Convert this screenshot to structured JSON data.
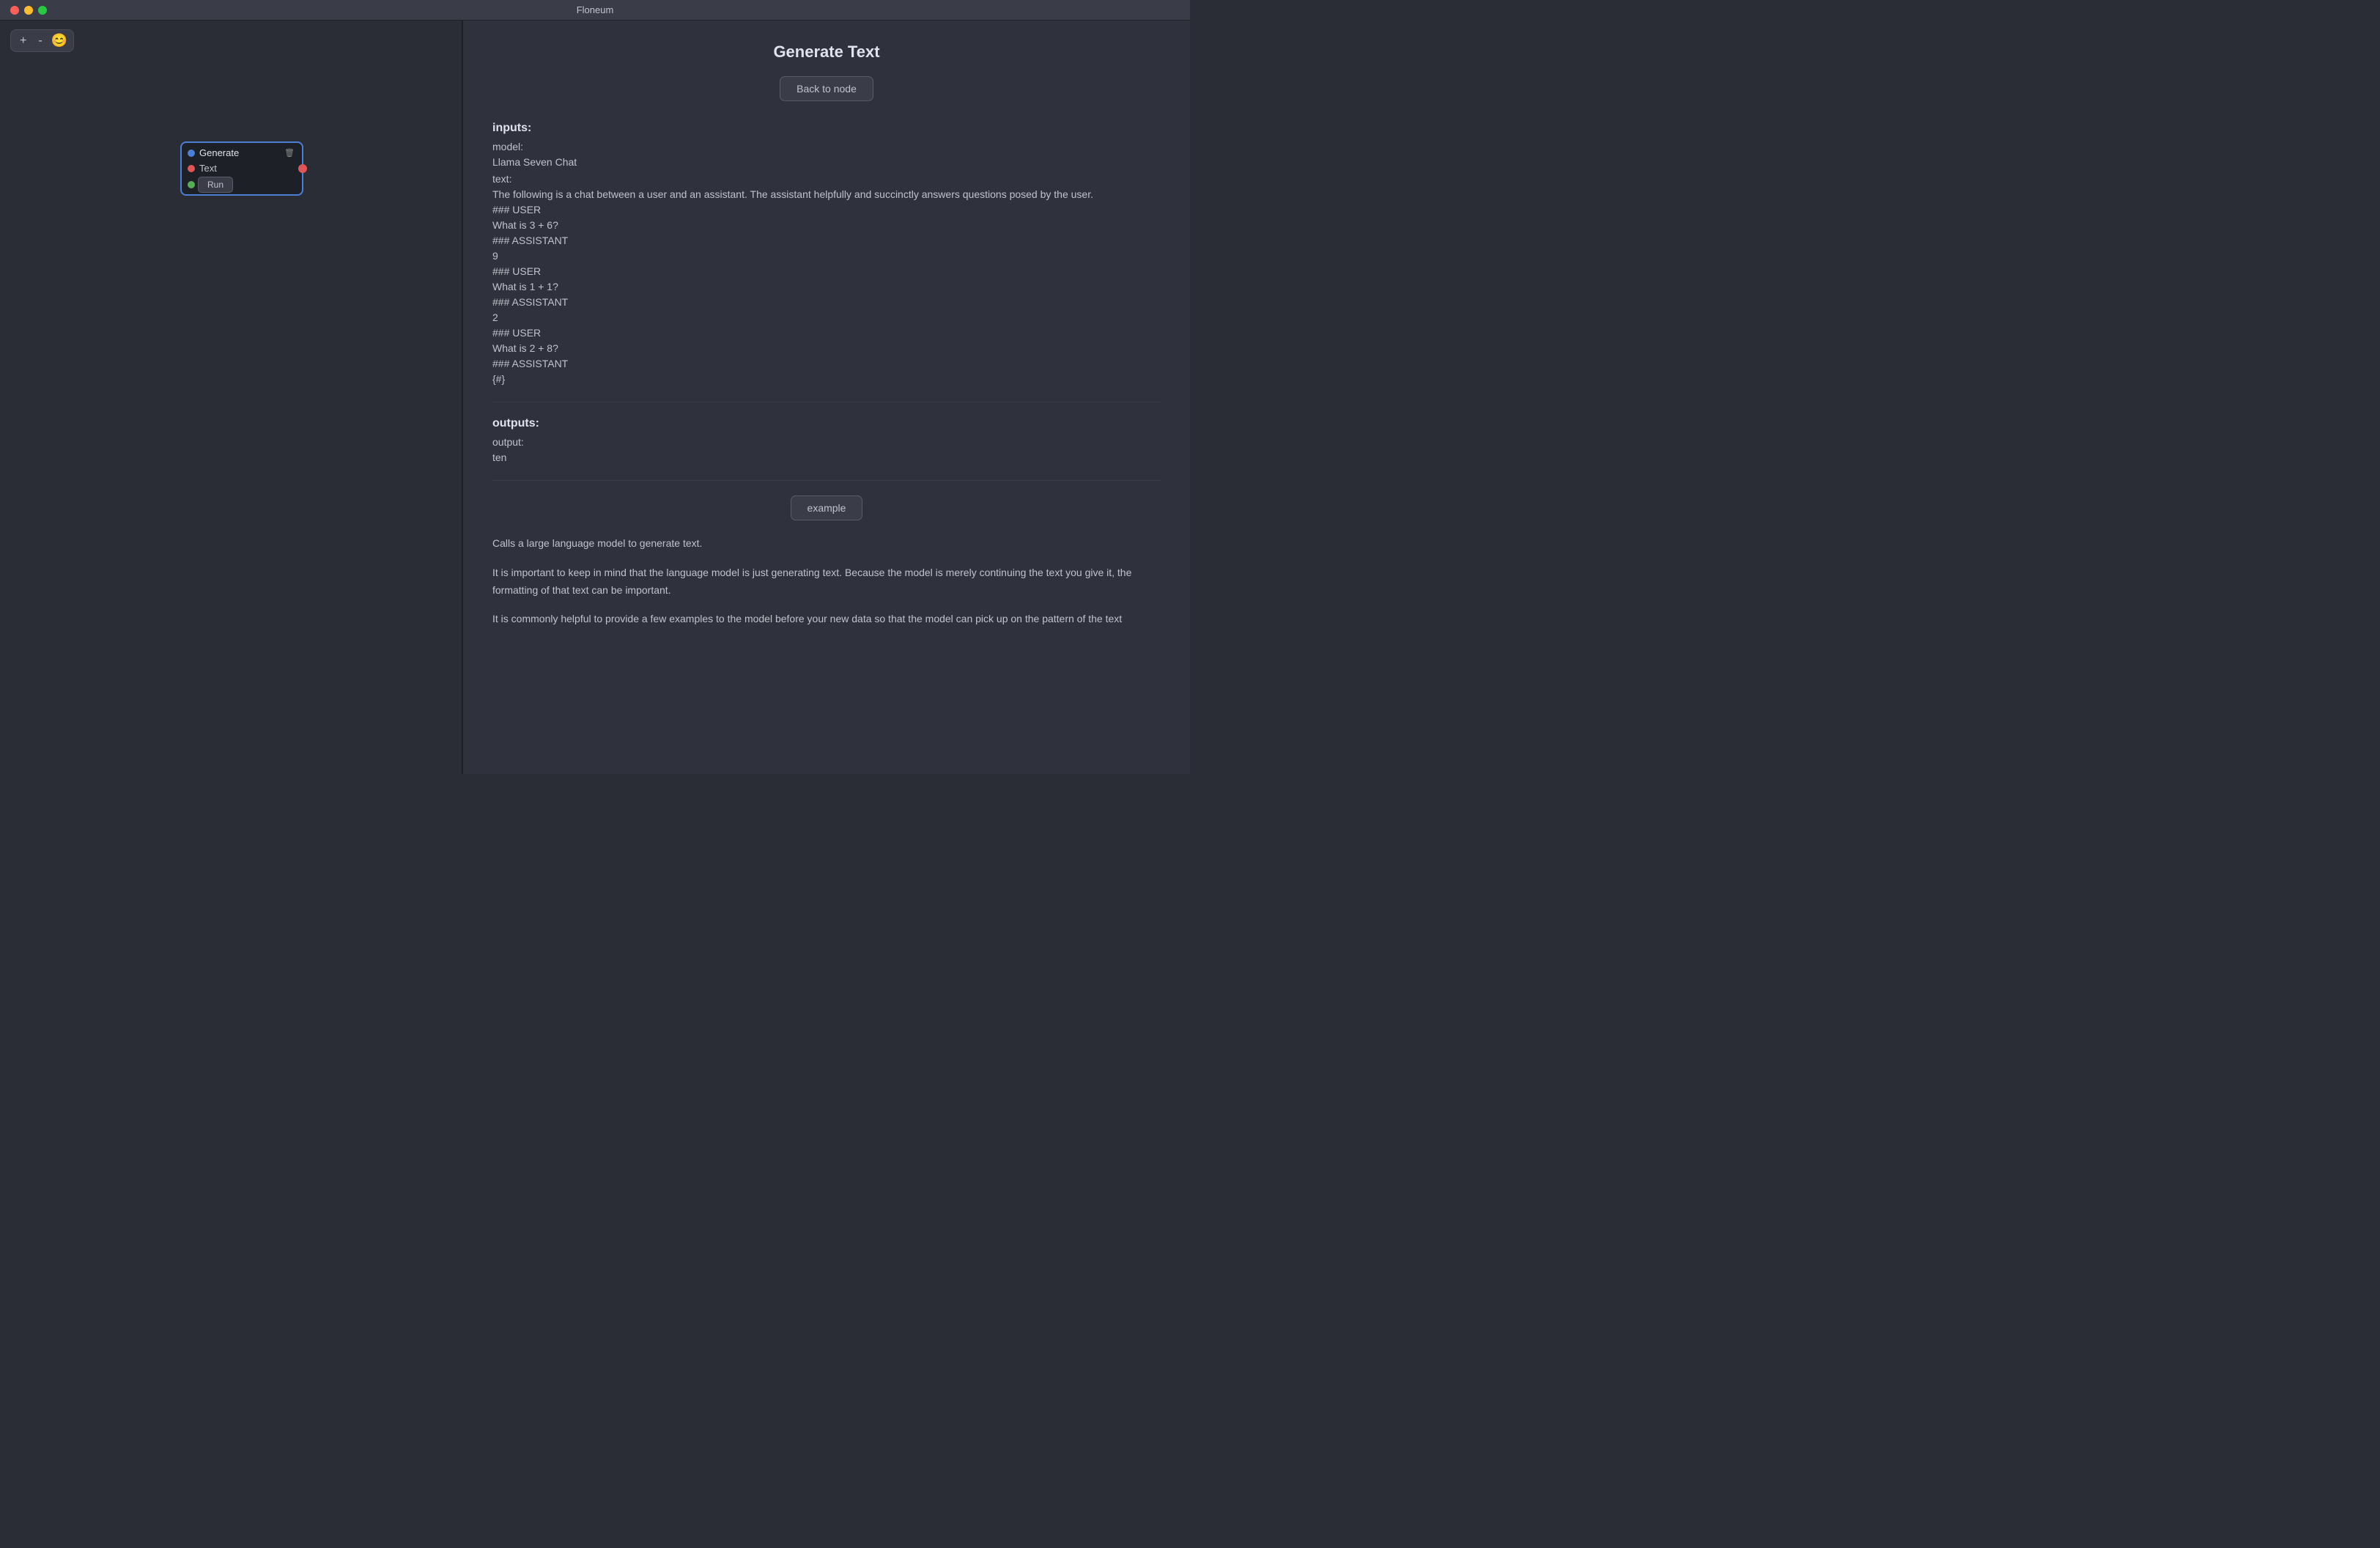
{
  "app": {
    "title": "Floneum"
  },
  "traffic_lights": {
    "close": "close",
    "minimize": "minimize",
    "maximize": "maximize"
  },
  "canvas": {
    "plus_label": "+",
    "minus_label": "-",
    "emoji_label": "😊"
  },
  "node": {
    "title_line1": "Generate",
    "title_line2": "Text",
    "dot_blue_label": "blue-dot",
    "dot_red_label": "red-dot",
    "dot_green_label": "green-dot",
    "run_label": "Run",
    "delete_label": "🗑"
  },
  "right_panel": {
    "title": "Generate Text",
    "back_button": "Back to node",
    "inputs_section": "inputs:",
    "model_label": "model:",
    "model_value": "Llama Seven Chat",
    "text_label": "text:",
    "text_value": "The following is a chat between a user and an assistant. The assistant helpfully and succinctly answers questions posed by the user.\n### USER\nWhat is 3 + 6?\n### ASSISTANT\n9\n### USER\nWhat is 1 + 1?\n### ASSISTANT\n2\n### USER\nWhat is 2 + 8?\n### ASSISTANT\n{#}",
    "outputs_section": "outputs:",
    "output_label": "output:",
    "output_value": "ten",
    "example_button": "example",
    "description1": "Calls a large language model to generate text.",
    "description2": "It is important to keep in mind that the language model is just generating text. Because the model is merely continuing the text you give it, the formatting of that text can be important.",
    "description3": "It is commonly helpful to provide a few examples to the model before your new data so that the model can pick up on the pattern of the text"
  }
}
